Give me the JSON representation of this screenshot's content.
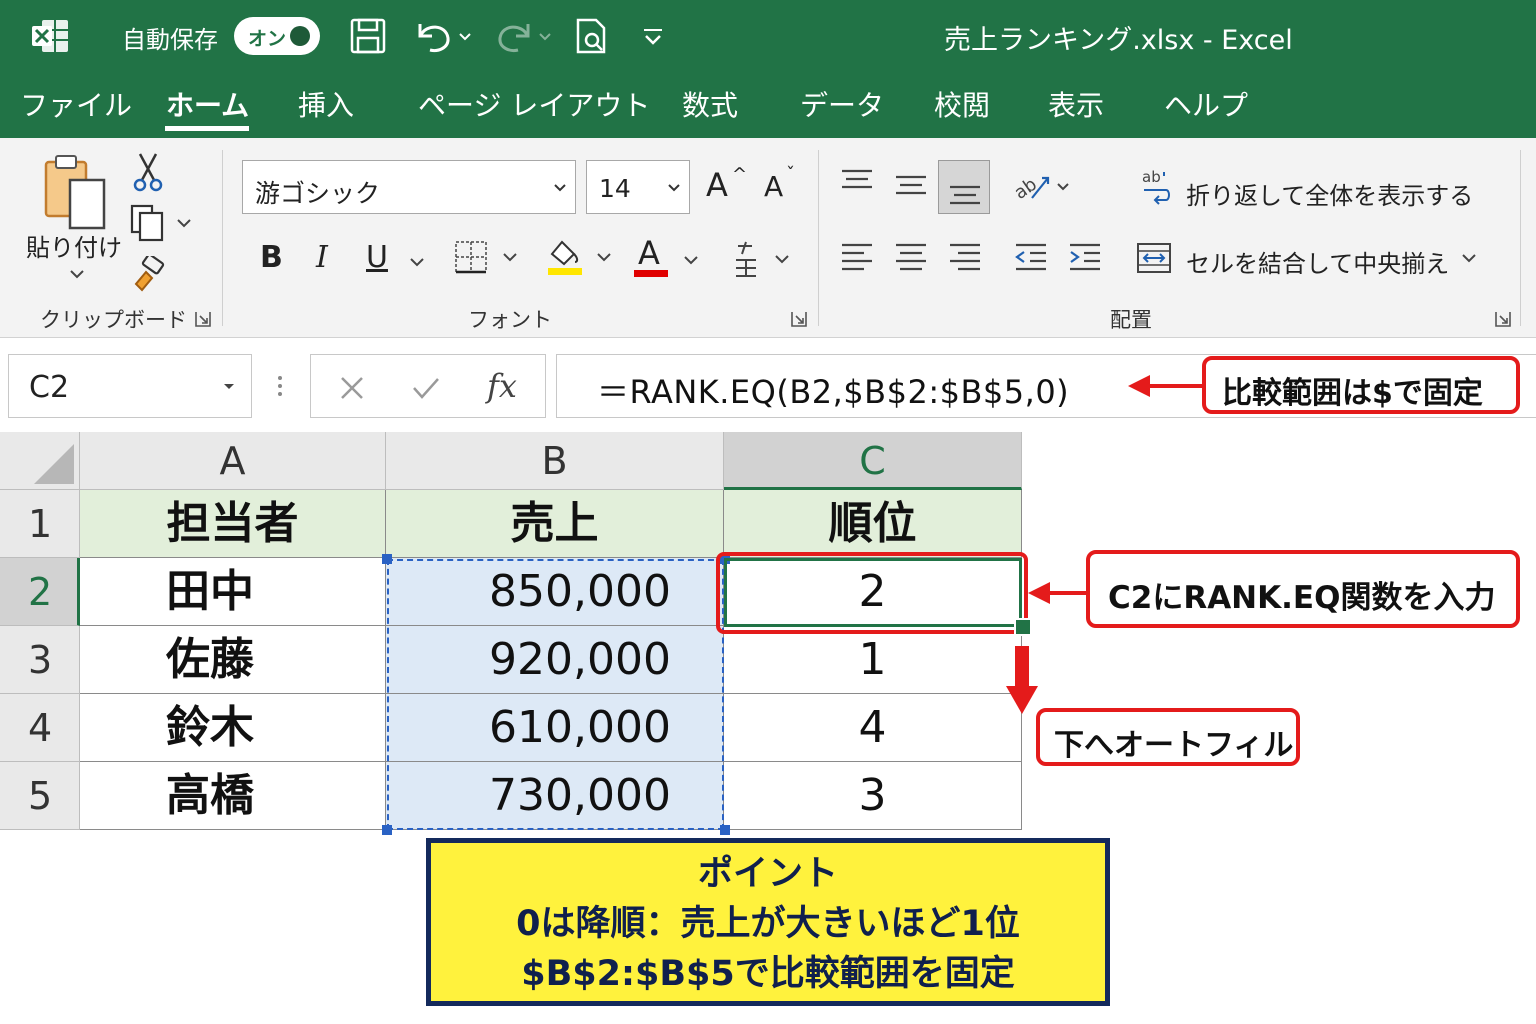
{
  "titlebar": {
    "autosave_label": "自動保存",
    "autosave_state": "オン",
    "document_title": "売上ランキング.xlsx  -  Excel",
    "bg_color": "#217346"
  },
  "tabs": [
    "ファイル",
    "ホーム",
    "挿入",
    "ページ レイアウト",
    "数式",
    "データ",
    "校閲",
    "表示",
    "ヘルプ"
  ],
  "active_tab": "ホーム",
  "ribbon": {
    "clipboard": {
      "paste_label": "貼り付け",
      "group_label": "クリップボード"
    },
    "font": {
      "font_name": "游ゴシック",
      "font_size": "14",
      "grow_label": "A",
      "shrink_label": "A",
      "bold": "B",
      "italic": "I",
      "underline": "U",
      "font_color_letter": "A",
      "group_label": "フォント",
      "highlight_color": "#ffe600",
      "font_color": "#e00000"
    },
    "alignment": {
      "wrap_text_label": "折り返して全体を表示する",
      "merge_center_label": "セルを結合して中央揃え",
      "group_label": "配置"
    }
  },
  "formula_bar": {
    "name_box": "C2",
    "fx_label": "fx",
    "formula": "＝RANK.EQ(B2,$B$2:$B$5,0)"
  },
  "sheet": {
    "columns": [
      "A",
      "B",
      "C"
    ],
    "row_numbers": [
      "1",
      "2",
      "3",
      "4",
      "5"
    ],
    "header": [
      "担当者",
      "売上",
      "順位"
    ],
    "rows": [
      {
        "name": "田中",
        "sales": "850,000",
        "rank": "2"
      },
      {
        "name": "佐藤",
        "sales": "920,000",
        "rank": "1"
      },
      {
        "name": "鈴木",
        "sales": "610,000",
        "rank": "4"
      },
      {
        "name": "高橋",
        "sales": "730,000",
        "rank": "3"
      }
    ],
    "header_fill": "#e2efda",
    "range_fill": "#dde9f6"
  },
  "annotations": {
    "range_note": "比較範囲は$で固定",
    "input_note": "C2にRANK.EQ関数を入力",
    "autofill_note": "下へオートフィル",
    "point": {
      "title": "ポイント",
      "line1": "0は降順：売上が大きいほど1位",
      "line2": "$B$2:$B$5で比較範囲を固定"
    },
    "accent_color": "#e41b1b",
    "point_fill": "#fff23d",
    "point_border": "#142a5c"
  }
}
